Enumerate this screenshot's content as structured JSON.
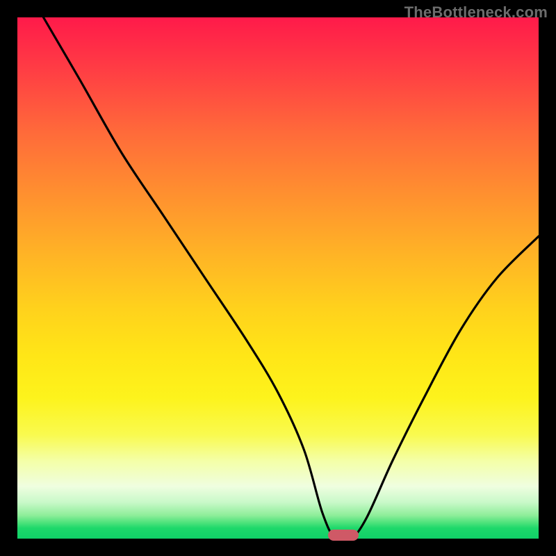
{
  "watermark": "TheBottleneck.com",
  "chart_data": {
    "type": "line",
    "title": "",
    "xlabel": "",
    "ylabel": "",
    "xlim": [
      0,
      100
    ],
    "ylim": [
      0,
      100
    ],
    "x": [
      5,
      12,
      20,
      28,
      36,
      44,
      50,
      55,
      58.5,
      61,
      64,
      67,
      72,
      78,
      85,
      92,
      100
    ],
    "values": [
      100,
      88,
      74,
      62,
      50,
      38,
      28,
      17,
      5,
      0,
      0,
      4,
      15,
      27,
      40,
      50,
      58
    ],
    "marker": {
      "x": 62.5,
      "y": 0
    },
    "gradient_stops": [
      {
        "pct": 0,
        "color": "#ff1a4a"
      },
      {
        "pct": 50,
        "color": "#ffd21c"
      },
      {
        "pct": 85,
        "color": "#f4ffa6"
      },
      {
        "pct": 100,
        "color": "#10d168"
      }
    ]
  }
}
